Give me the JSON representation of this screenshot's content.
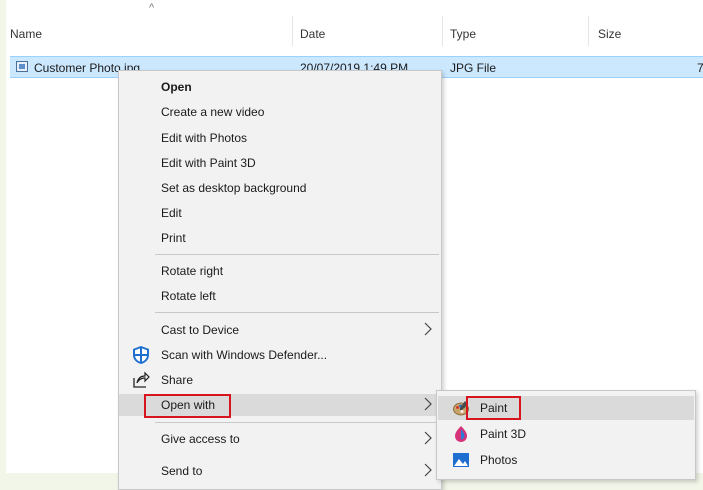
{
  "columns": {
    "name": "Name",
    "date": "Date",
    "type": "Type",
    "size": "Size"
  },
  "file": {
    "name": "Customer Photo.jpg",
    "date": "20/07/2019 1:49 PM",
    "type": "JPG File",
    "size": "7"
  },
  "context_menu": {
    "open": "Open",
    "create_video": "Create a new video",
    "edit_photos": "Edit with Photos",
    "edit_paint3d": "Edit with Paint 3D",
    "set_desktop": "Set as desktop background",
    "edit": "Edit",
    "print": "Print",
    "rotate_right": "Rotate right",
    "rotate_left": "Rotate left",
    "cast": "Cast to Device",
    "scan": "Scan with Windows Defender...",
    "share": "Share",
    "open_with": "Open with",
    "give_access": "Give access to",
    "send_to": "Send to"
  },
  "open_with_submenu": {
    "paint": "Paint",
    "paint3d": "Paint 3D",
    "photos": "Photos"
  },
  "colors": {
    "selection": "#cce8ff",
    "highlight_box": "#d8141e"
  }
}
